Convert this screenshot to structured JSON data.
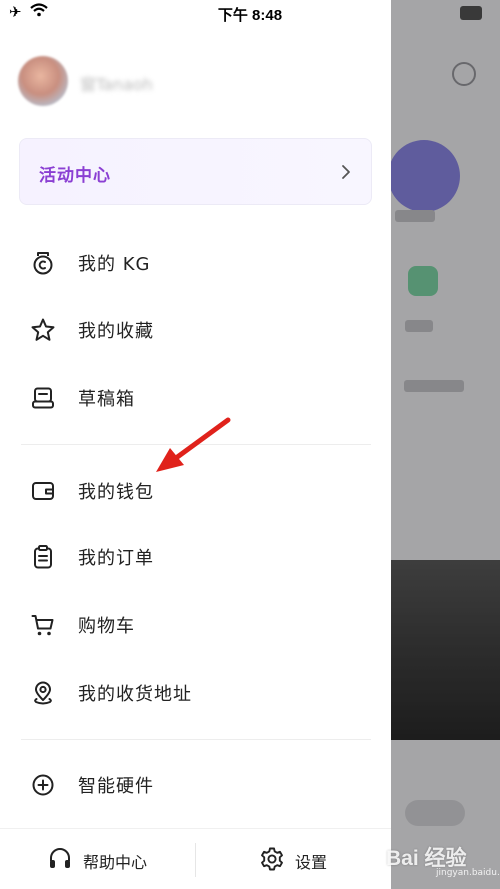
{
  "status_bar": {
    "time": "下午 8:48"
  },
  "profile": {
    "username": "窗Tanaoh"
  },
  "activity_center": {
    "label": "活动中心"
  },
  "menu_group_1": [
    {
      "label": "我的 KG",
      "icon": "kg-icon"
    },
    {
      "label": "我的收藏",
      "icon": "star-icon"
    },
    {
      "label": "草稿箱",
      "icon": "drafts-icon"
    }
  ],
  "menu_group_2": [
    {
      "label": "我的钱包",
      "icon": "wallet-icon"
    },
    {
      "label": "我的订单",
      "icon": "clipboard-icon"
    },
    {
      "label": "购物车",
      "icon": "cart-icon"
    },
    {
      "label": "我的收货地址",
      "icon": "location-pin-icon"
    }
  ],
  "menu_group_3": [
    {
      "label": "智能硬件",
      "icon": "plus-circle-icon"
    }
  ],
  "bottom_bar": {
    "help": "帮助中心",
    "settings": "设置"
  },
  "watermark": {
    "text": "Bai 经验",
    "sub": "jingyan.baidu.com"
  },
  "colors": {
    "accent": "#8b3fd3",
    "annotation_arrow": "#e0221b"
  }
}
